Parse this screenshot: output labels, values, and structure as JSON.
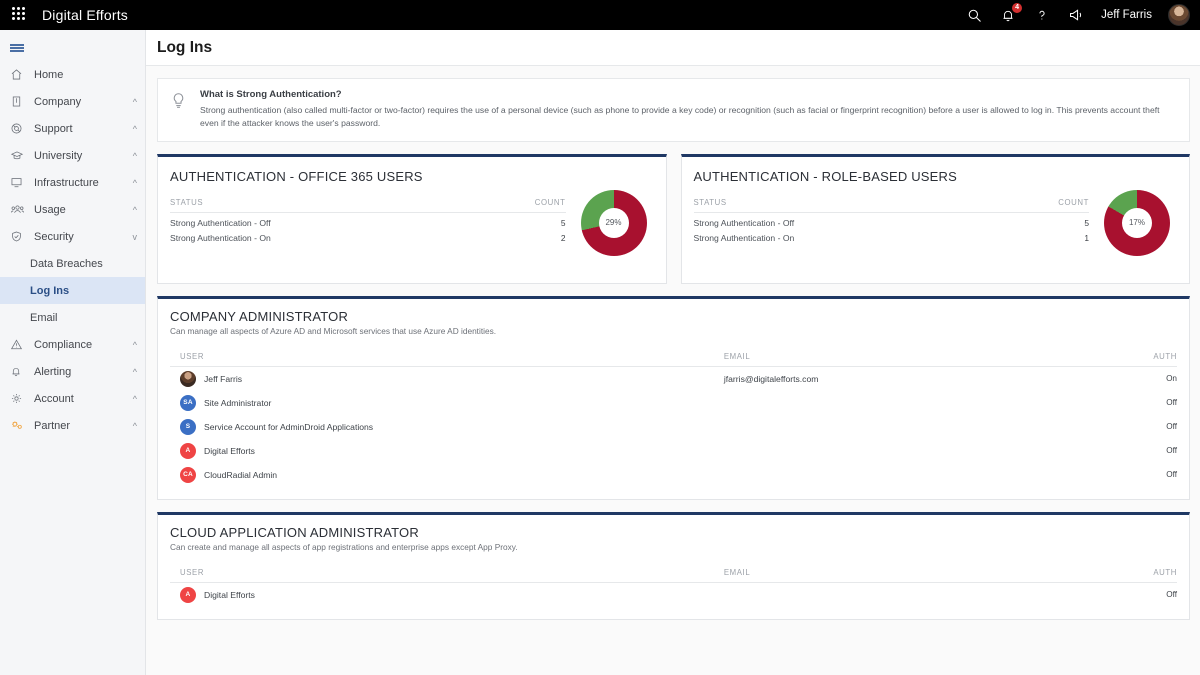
{
  "topbar": {
    "waffle_icon": "grid-apps-icon",
    "brand": "Digital Efforts",
    "search_icon": "search-icon",
    "bell_icon": "bell-icon",
    "notification_count": "4",
    "help_icon": "question-mark-icon",
    "feedback_icon": "megaphone-icon",
    "user_name": "Jeff Farris",
    "avatar_icon": "user-avatar"
  },
  "sidebar": {
    "hamburger_icon": "hamburger-menu-icon",
    "items": [
      {
        "label": "Home",
        "icon": "home-icon",
        "chevron": ""
      },
      {
        "label": "Company",
        "icon": "building-icon",
        "chevron": "^"
      },
      {
        "label": "Support",
        "icon": "lifebuoy-icon",
        "chevron": "^"
      },
      {
        "label": "University",
        "icon": "graduation-cap-icon",
        "chevron": "^"
      },
      {
        "label": "Infrastructure",
        "icon": "monitor-icon",
        "chevron": "^"
      },
      {
        "label": "Usage",
        "icon": "people-icon",
        "chevron": "^"
      },
      {
        "label": "Security",
        "icon": "shield-icon",
        "chevron": "v"
      }
    ],
    "security_children": [
      {
        "label": "Data Breaches",
        "active": false
      },
      {
        "label": "Log Ins",
        "active": true
      },
      {
        "label": "Email",
        "active": false
      }
    ],
    "items_after": [
      {
        "label": "Compliance",
        "icon": "warning-triangle-icon",
        "chevron": "^"
      },
      {
        "label": "Alerting",
        "icon": "bell-icon",
        "chevron": "^"
      },
      {
        "label": "Account",
        "icon": "gear-icon",
        "chevron": "^"
      },
      {
        "label": "Partner",
        "icon": "partner-gears-icon",
        "chevron": "^"
      }
    ]
  },
  "page": {
    "title": "Log Ins"
  },
  "info": {
    "icon": "lightbulb-icon",
    "title": "What is Strong Authentication?",
    "body": "Strong authentication (also called multi-factor or two-factor) requires the use of a personal device (such as phone to provide a key code) or recognition (such as facial or fingerprint recognition) before a user is allowed to log in. This prevents account theft even if the attacker knows the user's password."
  },
  "colors": {
    "accent_navy": "#1f3864",
    "status_off_red": "#a8112f",
    "status_on_green": "#4a9a4a",
    "donut_red": "#a8112f",
    "donut_green": "#5ba34f",
    "avatar_blue": "#3b6fc4",
    "avatar_red": "#ef4444",
    "partner_orange": "#f0a23c",
    "active_nav_bg": "#dbe5f5"
  },
  "chart_data": [
    {
      "type": "pie",
      "title": "AUTHENTICATION - OFFICE 365 USERS",
      "center_label": "29%",
      "columns": [
        "STATUS",
        "COUNT"
      ],
      "categories": [
        "Strong Authentication - Off",
        "Strong Authentication - On"
      ],
      "values": [
        5,
        2
      ],
      "colors": [
        "#a8112f",
        "#5ba34f"
      ],
      "legend": "inline-table",
      "donut": true
    },
    {
      "type": "pie",
      "title": "AUTHENTICATION - ROLE-BASED USERS",
      "center_label": "17%",
      "columns": [
        "STATUS",
        "COUNT"
      ],
      "categories": [
        "Strong Authentication - Off",
        "Strong Authentication - On"
      ],
      "values": [
        5,
        1
      ],
      "colors": [
        "#a8112f",
        "#5ba34f"
      ],
      "legend": "inline-table",
      "donut": true
    }
  ],
  "panels": [
    {
      "title": "COMPANY ADMINISTRATOR",
      "subtitle": "Can manage all aspects of Azure AD and Microsoft services that use Azure AD identities.",
      "columns": [
        "USER",
        "EMAIL",
        "AUTH"
      ],
      "rows": [
        {
          "user": "Jeff Farris",
          "email": "jfarris@digitalefforts.com",
          "auth": "On",
          "initials": "",
          "avatar": "photo",
          "color": ""
        },
        {
          "user": "Site Administrator",
          "email": "",
          "auth": "Off",
          "initials": "SA",
          "avatar": "initials",
          "color": "#3b6fc4"
        },
        {
          "user": "Service Account for AdminDroid Applications",
          "email": "",
          "auth": "Off",
          "initials": "S",
          "avatar": "initials",
          "color": "#3b6fc4"
        },
        {
          "user": "Digital Efforts",
          "email": "",
          "auth": "Off",
          "initials": "A",
          "avatar": "initials",
          "color": "#ef4444"
        },
        {
          "user": "CloudRadial Admin",
          "email": "",
          "auth": "Off",
          "initials": "CA",
          "avatar": "initials",
          "color": "#ef4444"
        }
      ]
    },
    {
      "title": "CLOUD APPLICATION ADMINISTRATOR",
      "subtitle": "Can create and manage all aspects of app registrations and enterprise apps except App Proxy.",
      "columns": [
        "USER",
        "EMAIL",
        "AUTH"
      ],
      "rows": [
        {
          "user": "Digital Efforts",
          "email": "",
          "auth": "Off",
          "initials": "A",
          "avatar": "initials",
          "color": "#ef4444"
        }
      ]
    }
  ]
}
